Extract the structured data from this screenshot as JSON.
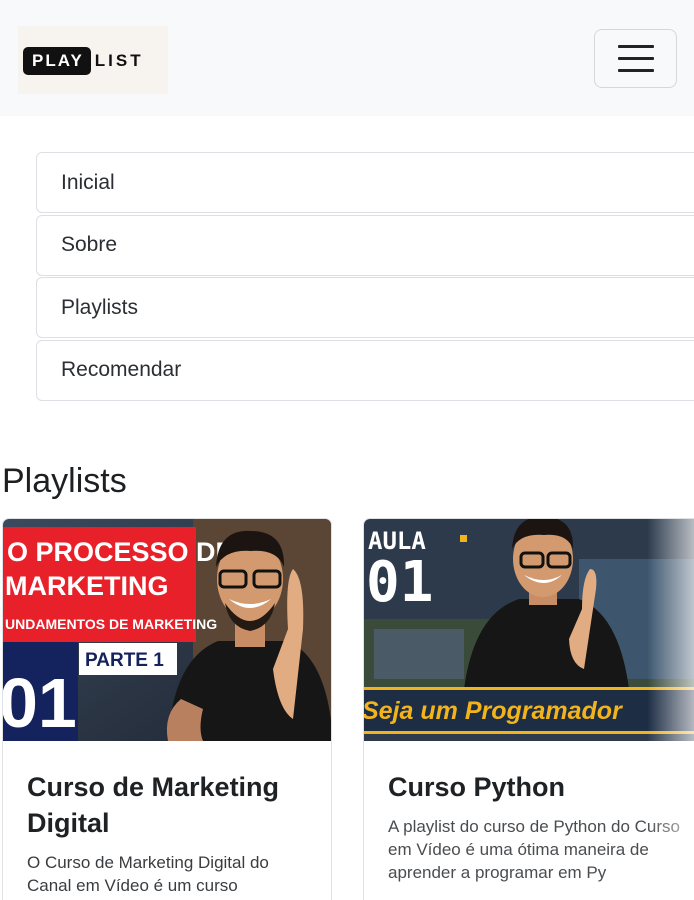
{
  "brand": {
    "logo_part1": "PLAY",
    "logo_part2": "LIST"
  },
  "nav": {
    "items": [
      {
        "label": "Inicial"
      },
      {
        "label": "Sobre"
      },
      {
        "label": "Playlists"
      },
      {
        "label": "Recomendar"
      }
    ]
  },
  "section": {
    "title": "Playlists"
  },
  "cards": [
    {
      "title": "Curso de Marketing Digital",
      "text": "O Curso de Marketing Digital do Canal em Vídeo é um curso",
      "thumb": {
        "line1": "O PROCESSO DE",
        "line2": "MARKETING",
        "line3": "UNDAMENTOS DE MARKETING",
        "part": "PARTE 1",
        "number": "01"
      }
    },
    {
      "title": "Curso Python",
      "text": "A playlist do curso de Python do Curso em Vídeo é uma ótima maneira de aprender a programar em Py",
      "thumb": {
        "line1": "AULA",
        "number": "01",
        "banner": "Seja um Programador"
      }
    }
  ],
  "colors": {
    "marketing_red": "#e8202a",
    "marketing_navy": "#14225e",
    "python_yellow": "#f2b31b",
    "python_bg": "#2c3a4c"
  }
}
